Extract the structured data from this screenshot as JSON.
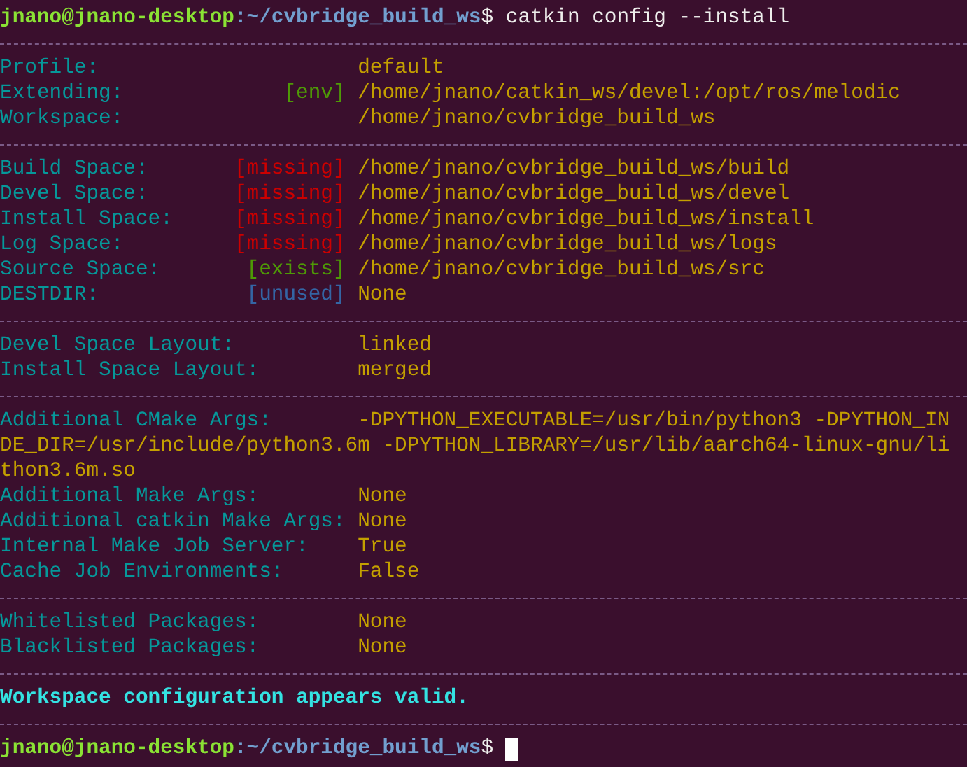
{
  "prompt": {
    "user_host": "jnano@jnano-desktop",
    "path": ":~/cvbridge_build_ws",
    "symbol": "$",
    "command": "catkin config --install"
  },
  "sections": [
    {
      "rows": [
        {
          "label": "Profile:",
          "value": "default"
        },
        {
          "label": "Extending:",
          "tag": "[env]",
          "color": "#4e9a06",
          "value": "/home/jnano/catkin_ws/devel:/opt/ros/melodic"
        },
        {
          "label": "Workspace:",
          "value": "/home/jnano/cvbridge_build_ws"
        }
      ]
    },
    {
      "rows": [
        {
          "label": "Build Space:",
          "tag": "[missing]",
          "color": "#cc0000",
          "value": "/home/jnano/cvbridge_build_ws/build"
        },
        {
          "label": "Devel Space:",
          "tag": "[missing]",
          "color": "#cc0000",
          "value": "/home/jnano/cvbridge_build_ws/devel"
        },
        {
          "label": "Install Space:",
          "tag": "[missing]",
          "color": "#cc0000",
          "value": "/home/jnano/cvbridge_build_ws/install"
        },
        {
          "label": "Log Space:",
          "tag": "[missing]",
          "color": "#cc0000",
          "value": "/home/jnano/cvbridge_build_ws/logs"
        },
        {
          "label": "Source Space:",
          "tag": "[exists]",
          "color": "#4e9a06",
          "value": "/home/jnano/cvbridge_build_ws/src"
        },
        {
          "label": "DESTDIR:",
          "tag": "[unused]",
          "color": "#3465a4",
          "value": "None"
        }
      ]
    },
    {
      "rows": [
        {
          "label": "Devel Space Layout:",
          "value": "linked"
        },
        {
          "label": "Install Space Layout:",
          "value": "merged"
        }
      ]
    },
    {
      "rows": [
        {
          "label": "Additional CMake Args:",
          "value": "-DPYTHON_EXECUTABLE=/usr/bin/python3 -DPYTHON_IN",
          "continuation": [
            "DE_DIR=/usr/include/python3.6m -DPYTHON_LIBRARY=/usr/lib/aarch64-linux-gnu/li",
            "thon3.6m.so"
          ]
        },
        {
          "label": "Additional Make Args:",
          "value": "None"
        },
        {
          "label": "Additional catkin Make Args:",
          "value": "None"
        },
        {
          "label": "Internal Make Job Server:",
          "value": "True"
        },
        {
          "label": "Cache Job Environments:",
          "value": "False"
        }
      ]
    },
    {
      "rows": [
        {
          "label": "Whitelisted Packages:",
          "value": "None"
        },
        {
          "label": "Blacklisted Packages:",
          "value": "None"
        }
      ]
    },
    {
      "rows": [
        {
          "kind": "message",
          "value": "Workspace configuration appears valid."
        }
      ]
    }
  ],
  "final_prompt": {
    "user_host": "jnano@jnano-desktop",
    "path": ":~/cvbridge_build_ws",
    "symbol": "$"
  }
}
